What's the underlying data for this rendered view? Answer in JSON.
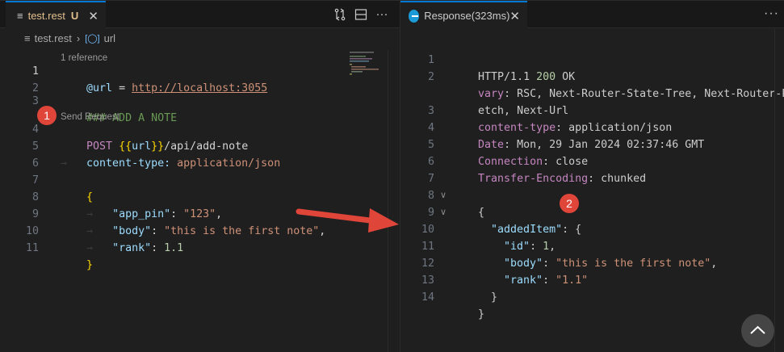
{
  "left": {
    "tab": {
      "icon": "text-file-icon",
      "title": "test.rest",
      "status": "U"
    },
    "breadcrumb": {
      "file": "test.rest",
      "symbol": "url"
    },
    "lens_reference": "1 reference",
    "lens_send": "Send Request",
    "line_numbers": [
      "1",
      "2",
      "3",
      "4",
      "5",
      "6",
      "7",
      "8",
      "9",
      "10",
      "11"
    ],
    "code": {
      "l1_var": "@url",
      "l1_eq": " = ",
      "l1_url": "http://localhost:3055",
      "l3_comment": "### ADD A NOTE",
      "l4_method": "POST ",
      "l4_open": "{{",
      "l4_var": "url",
      "l4_close": "}}",
      "l4_path": "/api/add-note",
      "l5_header": "content-type: ",
      "l5_value": "application/json",
      "l7_brace": "{",
      "l8_key": "\"app_pin\"",
      "l8_colon": ": ",
      "l8_val": "\"123\"",
      "l8_comma": ",",
      "l9_key": "\"body\"",
      "l9_colon": ": ",
      "l9_val": "\"this is the first note\"",
      "l9_comma": ",",
      "l10_key": "\"rank\"",
      "l10_colon": ": ",
      "l10_val": "1.1",
      "l11_brace": "}"
    },
    "badge": "1"
  },
  "right": {
    "tab": {
      "title": "Response(323ms)"
    },
    "more": "···",
    "line_numbers": [
      "1",
      "2",
      "",
      "3",
      "4",
      "5",
      "6",
      "7",
      "8",
      "9",
      "10",
      "11",
      "12",
      "13",
      "14"
    ],
    "lines": {
      "l1_proto": "HTTP/1.1 ",
      "l1_code": "200",
      "l1_status": " OK",
      "l2_name": "vary",
      "l2_value": ": RSC, Next-Router-State-Tree, Next-Router-Pref",
      "l2_wrap": "etch, Next-Url",
      "l3_name": "content-type",
      "l3_value": ": application/json",
      "l4_name": "Date",
      "l4_value": ": Mon, 29 Jan 2024 02:37:46 GMT",
      "l5_name": "Connection",
      "l5_value": ": close",
      "l6_name": "Transfer-Encoding",
      "l6_value": ": chunked",
      "l8_brace": "{",
      "l9_key": "\"addedItem\"",
      "l9_rest": ": {",
      "l10_key": "\"id\"",
      "l10_colon": ": ",
      "l10_val": "1",
      "l10_comma": ",",
      "l11_key": "\"body\"",
      "l11_colon": ": ",
      "l11_val": "\"this is the first note\"",
      "l11_comma": ",",
      "l12_key": "\"rank\"",
      "l12_colon": ": ",
      "l12_val": "\"1.1\"",
      "l13_brace": "}",
      "l14_brace": "}"
    },
    "badge": "2"
  },
  "colors": {
    "accent": "#0078d4",
    "badge": "#e0453a",
    "arrow": "#e0453a"
  }
}
